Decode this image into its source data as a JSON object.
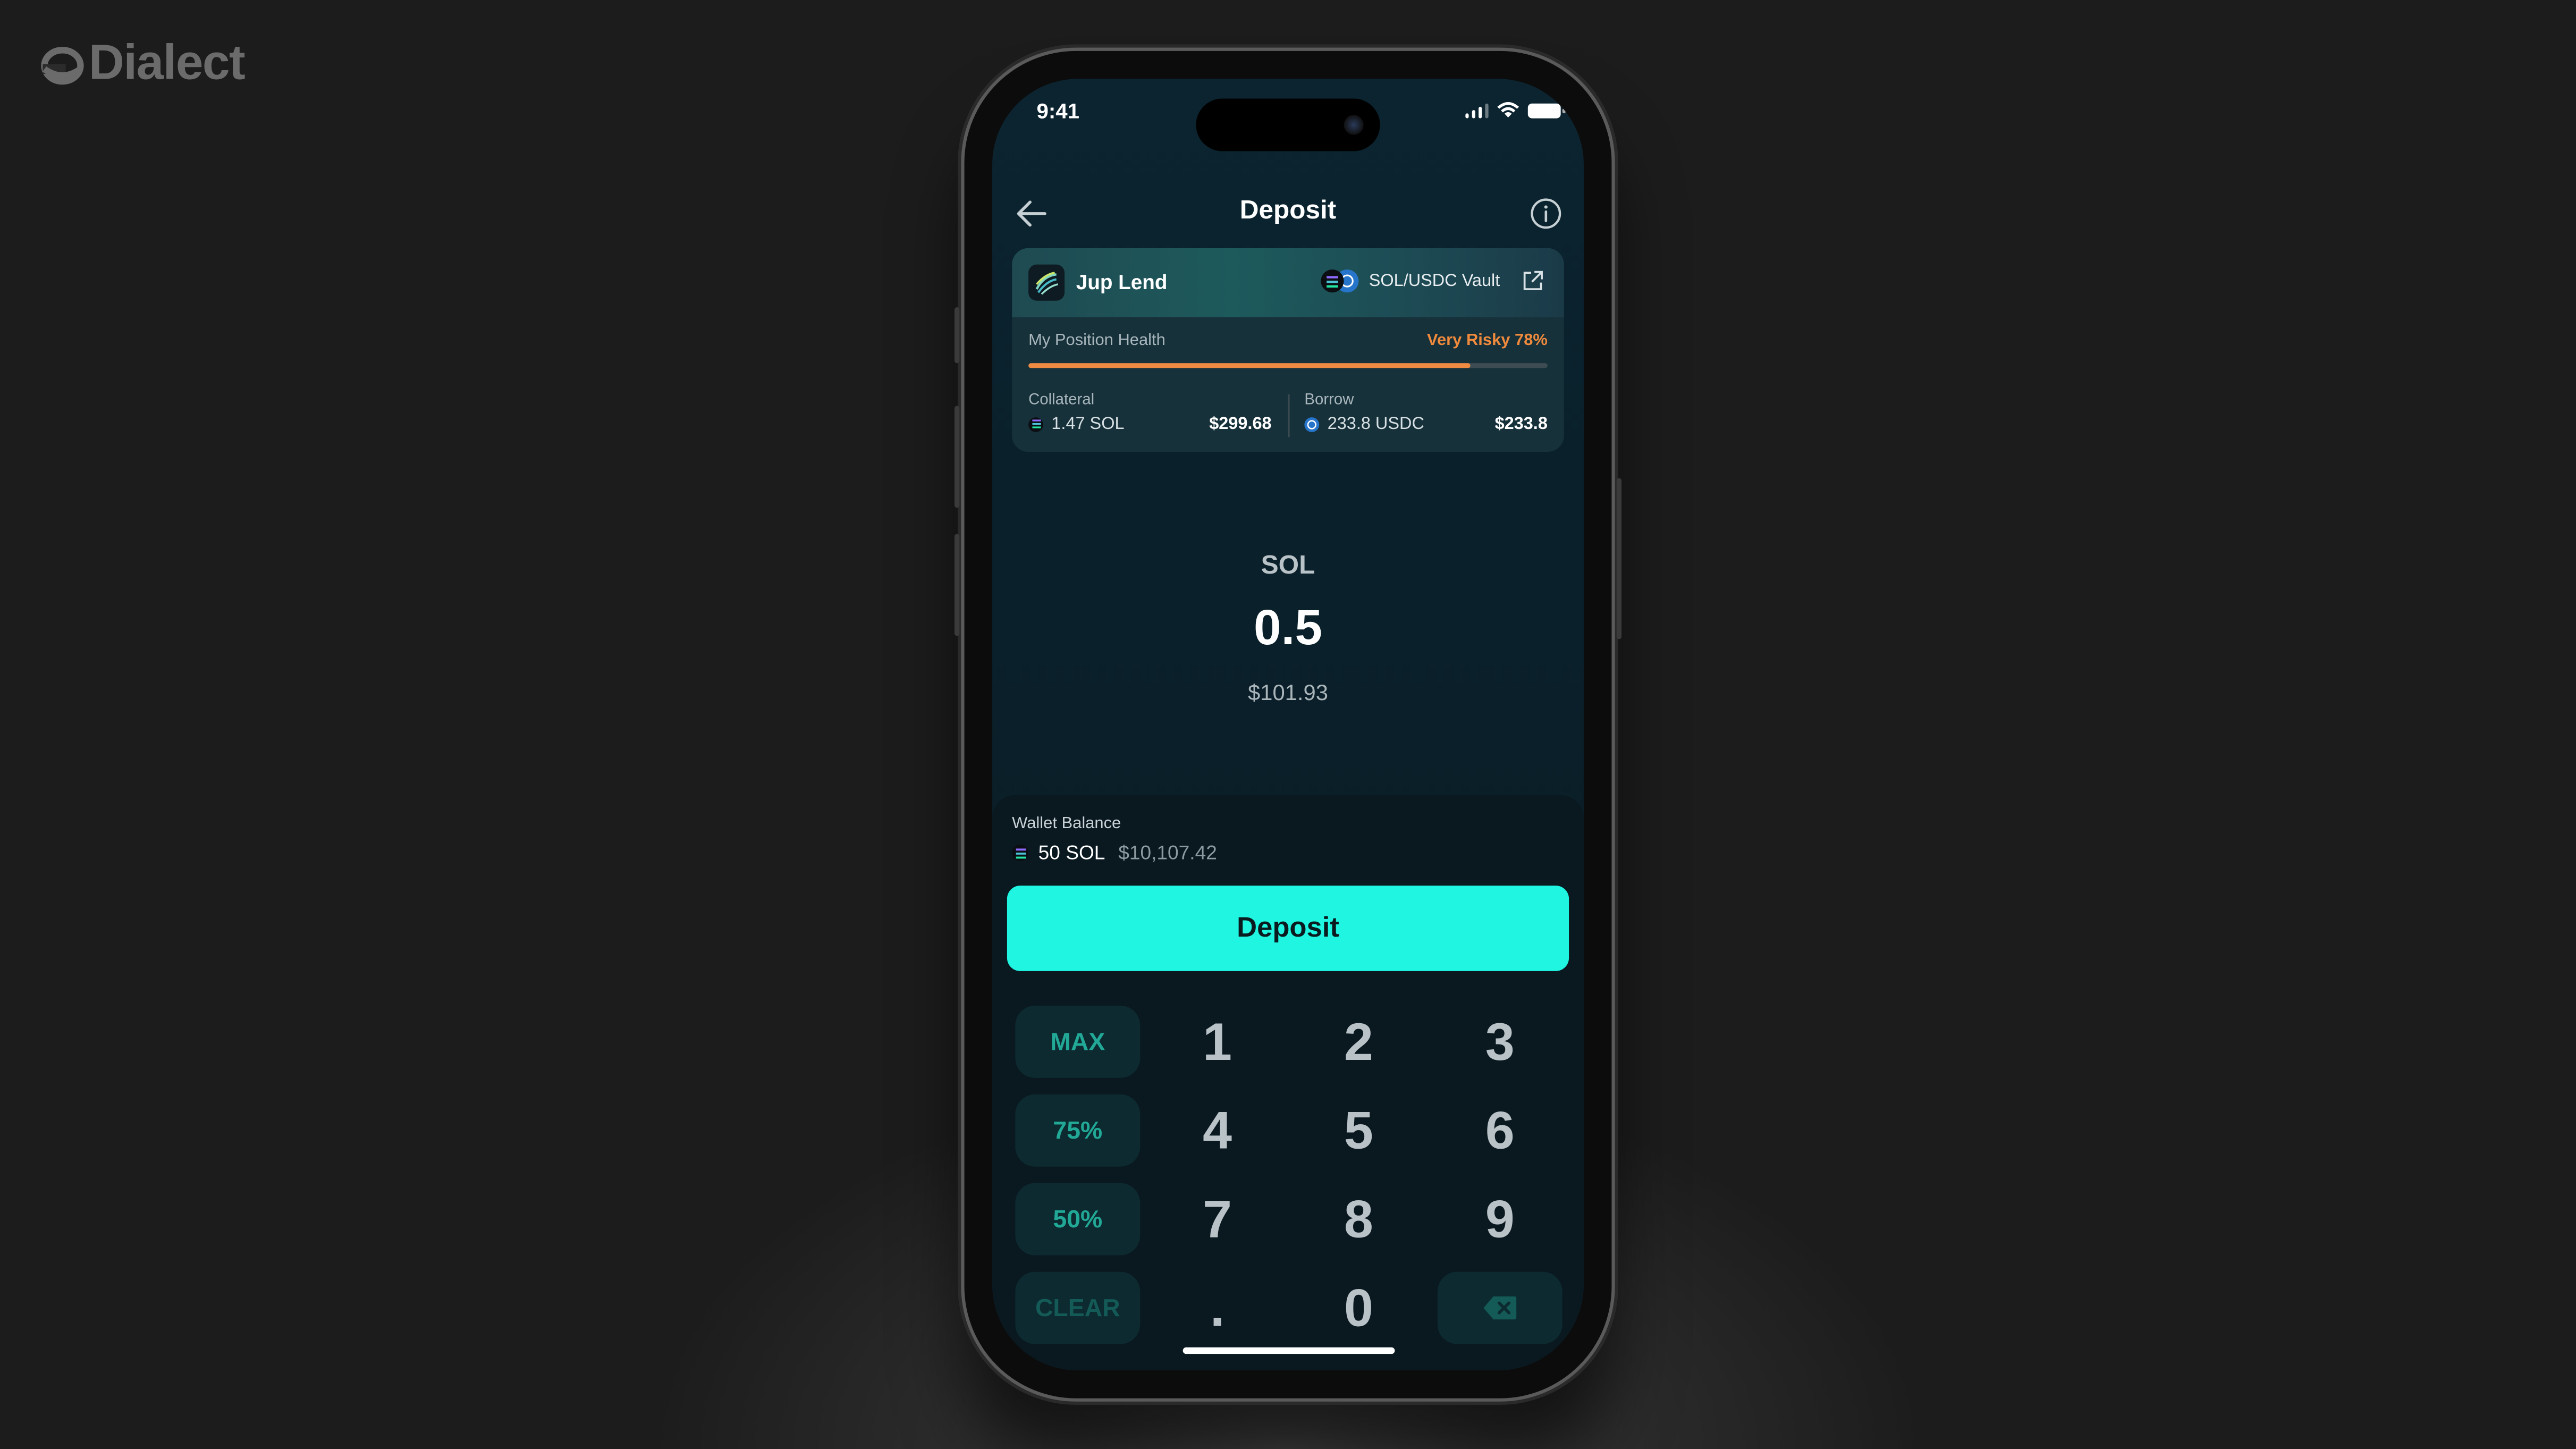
{
  "brand": {
    "name": "Dialect"
  },
  "status_bar": {
    "time": "9:41"
  },
  "nav": {
    "title": "Deposit",
    "back_icon": "arrow-left-icon",
    "info_icon": "info-circle-icon"
  },
  "position_card": {
    "protocol": "Jup Lend",
    "vault": "SOL/USDC Vault",
    "health_label": "My Position Health",
    "health_value": "Very Risky 78%",
    "health_fraction": 0.85,
    "collateral": {
      "label": "Collateral",
      "amount": "1.47 SOL",
      "usd": "$299.68"
    },
    "borrow": {
      "label": "Borrow",
      "amount": "233.8 USDC",
      "usd": "$233.8"
    }
  },
  "amount": {
    "token": "SOL",
    "value": "0.5",
    "usd": "$101.93"
  },
  "wallet": {
    "label": "Wallet Balance",
    "amount": "50 SOL",
    "usd": "$10,107.42"
  },
  "action": {
    "deposit_label": "Deposit"
  },
  "keypad": {
    "shortcuts": [
      "MAX",
      "75%",
      "50%",
      "CLEAR"
    ],
    "digits": [
      "1",
      "2",
      "3",
      "4",
      "5",
      "6",
      "7",
      "8",
      "9",
      ".",
      "0"
    ],
    "backspace_icon": "backspace-icon"
  },
  "colors": {
    "accent": "#1ff5e0",
    "risk": "#ef8a43",
    "screen_bg": "#0b2430",
    "shortcut_text": "#22a896"
  }
}
